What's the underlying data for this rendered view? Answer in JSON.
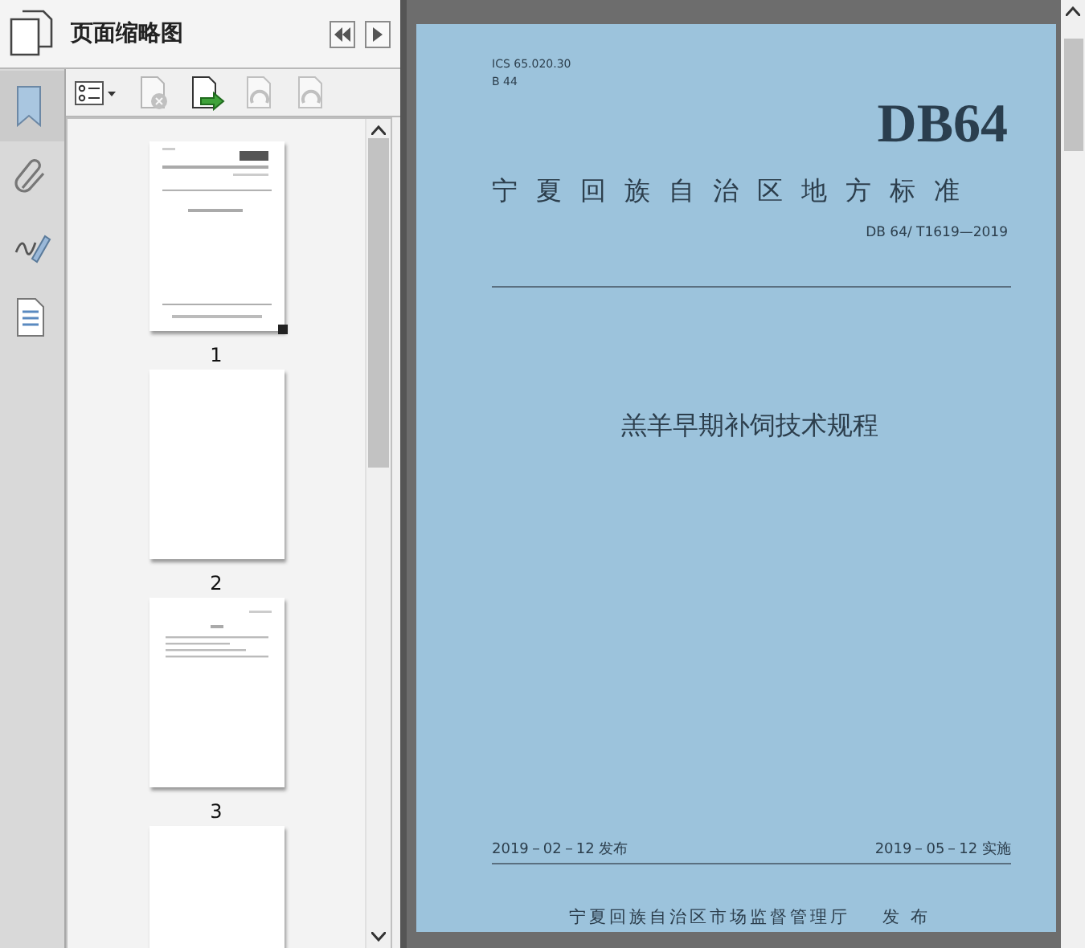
{
  "sidebar": {
    "items": [
      {
        "kind": "bookmark",
        "selected": true
      },
      {
        "kind": "attachment",
        "selected": false
      },
      {
        "kind": "signature",
        "selected": false
      },
      {
        "kind": "layers",
        "selected": false
      }
    ]
  },
  "panel": {
    "title": "页面缩略图",
    "toolbar": [
      {
        "kind": "options",
        "disabled": false
      },
      {
        "kind": "delete",
        "disabled": true
      },
      {
        "kind": "extract",
        "disabled": false
      },
      {
        "kind": "rotate-left",
        "disabled": true
      },
      {
        "kind": "rotate-right",
        "disabled": true
      }
    ],
    "thumbnails": [
      {
        "kind": "cover",
        "label": "1",
        "current": true
      },
      {
        "kind": "blank",
        "label": "2",
        "current": false
      },
      {
        "kind": "foreword",
        "label": "3",
        "current": false
      },
      {
        "kind": "blank"
      }
    ]
  },
  "document": {
    "ics": "ICS 65.020.30",
    "class_code": "B 44",
    "code": "DB64",
    "authority": "宁夏回族自治区地方标准",
    "number": "DB 64/ T1619—2019",
    "title": "羔羊早期补饲技术规程",
    "publish_date": "2019－02－12 发布",
    "effective_date": "2019－05－12 实施",
    "issuer": "宁夏回族自治区市场监督管理厅",
    "issue_word": "发 布"
  }
}
